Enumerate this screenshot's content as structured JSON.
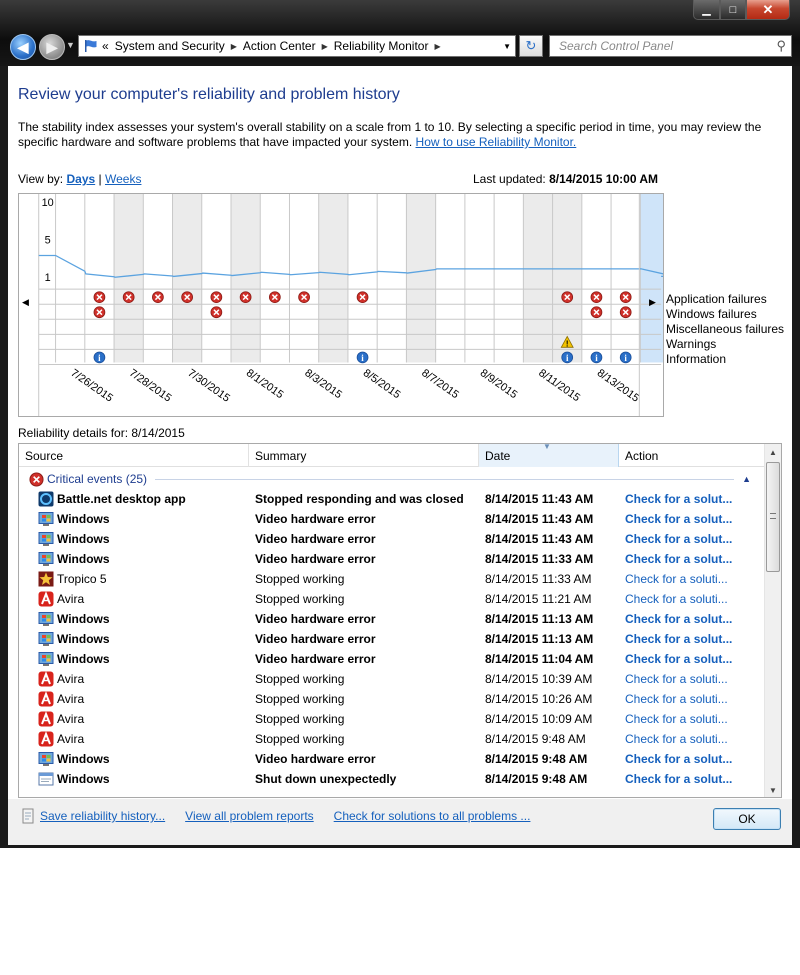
{
  "window": {
    "buttons": {
      "min": "▁",
      "max": "□",
      "close": "✕"
    }
  },
  "address": {
    "overflow": "«",
    "crumbs": [
      "System and Security",
      "Action Center",
      "Reliability Monitor"
    ],
    "search_placeholder": "Search Control Panel"
  },
  "page": {
    "title": "Review your computer's reliability and problem history",
    "description": "The stability index assesses your system's overall stability on a scale from 1 to 10. By selecting a specific period in time, you may review the specific hardware and software problems that have impacted your system.",
    "help_link": "How to use Reliability Monitor.",
    "view_by_label": "View by:",
    "view_days": "Days",
    "view_separator": "|",
    "view_weeks": "Weeks",
    "last_updated_label": "Last updated:",
    "last_updated_value": "8/14/2015 10:00 AM"
  },
  "chart": {
    "y_ticks": [
      "10",
      "5",
      "1"
    ],
    "date_labels": [
      "7/26/2015",
      "7/28/2015",
      "7/30/2015",
      "8/1/2015",
      "8/3/2015",
      "8/5/2015",
      "8/7/2015",
      "8/9/2015",
      "8/11/2015",
      "8/13/2015"
    ],
    "legend": [
      "Application failures",
      "Windows failures",
      "Miscellaneous failures",
      "Warnings",
      "Information"
    ],
    "selected_date": "8/14/2015",
    "stability_index": [
      3.6,
      1.4,
      1.0,
      1.4,
      1.1,
      1.5,
      1.2,
      1.6,
      1.3,
      1.6,
      1.3,
      1.7,
      1.5,
      2.0,
      2.0,
      2.0,
      2.0,
      2.0,
      2.0,
      2.0,
      2.0,
      1.1
    ],
    "application_failure_columns": [
      2,
      3,
      4,
      5,
      6,
      7,
      8,
      9,
      11,
      18,
      19,
      20
    ],
    "windows_failure_columns": [
      2,
      6,
      19,
      20
    ],
    "warning_columns": [
      18
    ],
    "information_columns": [
      2,
      11,
      18,
      19,
      20
    ]
  },
  "details": {
    "label": "Reliability details for: 8/14/2015",
    "columns": {
      "source": "Source",
      "summary": "Summary",
      "date": "Date",
      "action": "Action"
    },
    "group_label": "Critical events (25)",
    "rows": [
      {
        "source": "Battle.net desktop app",
        "icon": "battlenet-icon",
        "summary": "Stopped responding and was closed",
        "date": "8/14/2015 11:43 AM",
        "action": "Check for a solut...",
        "bold": true
      },
      {
        "source": "Windows",
        "icon": "windows-monitor-icon",
        "summary": "Video hardware error",
        "date": "8/14/2015 11:43 AM",
        "action": "Check for a solut...",
        "bold": true
      },
      {
        "source": "Windows",
        "icon": "windows-monitor-icon",
        "summary": "Video hardware error",
        "date": "8/14/2015 11:43 AM",
        "action": "Check for a solut...",
        "bold": true
      },
      {
        "source": "Windows",
        "icon": "windows-monitor-icon",
        "summary": "Video hardware error",
        "date": "8/14/2015 11:33 AM",
        "action": "Check for a solut...",
        "bold": true
      },
      {
        "source": "Tropico 5",
        "icon": "tropico-star-icon",
        "summary": "Stopped working",
        "date": "8/14/2015 11:33 AM",
        "action": "Check for a soluti...",
        "bold": false
      },
      {
        "source": "Avira",
        "icon": "avira-icon",
        "summary": "Stopped working",
        "date": "8/14/2015 11:21 AM",
        "action": "Check for a soluti...",
        "bold": false
      },
      {
        "source": "Windows",
        "icon": "windows-monitor-icon",
        "summary": "Video hardware error",
        "date": "8/14/2015 11:13 AM",
        "action": "Check for a solut...",
        "bold": true
      },
      {
        "source": "Windows",
        "icon": "windows-monitor-icon",
        "summary": "Video hardware error",
        "date": "8/14/2015 11:13 AM",
        "action": "Check for a solut...",
        "bold": true
      },
      {
        "source": "Windows",
        "icon": "windows-monitor-icon",
        "summary": "Video hardware error",
        "date": "8/14/2015 11:04 AM",
        "action": "Check for a solut...",
        "bold": true
      },
      {
        "source": "Avira",
        "icon": "avira-icon",
        "summary": "Stopped working",
        "date": "8/14/2015 10:39 AM",
        "action": "Check for a soluti...",
        "bold": false
      },
      {
        "source": "Avira",
        "icon": "avira-icon",
        "summary": "Stopped working",
        "date": "8/14/2015 10:26 AM",
        "action": "Check for a soluti...",
        "bold": false
      },
      {
        "source": "Avira",
        "icon": "avira-icon",
        "summary": "Stopped working",
        "date": "8/14/2015 10:09 AM",
        "action": "Check for a soluti...",
        "bold": false
      },
      {
        "source": "Avira",
        "icon": "avira-icon",
        "summary": "Stopped working",
        "date": "8/14/2015 9:48 AM",
        "action": "Check for a soluti...",
        "bold": false
      },
      {
        "source": "Windows",
        "icon": "windows-monitor-icon",
        "summary": "Video hardware error",
        "date": "8/14/2015 9:48 AM",
        "action": "Check for a solut...",
        "bold": true
      },
      {
        "source": "Windows",
        "icon": "windows-window-icon",
        "summary": "Shut down unexpectedly",
        "date": "8/14/2015 9:48 AM",
        "action": "Check for a solut...",
        "bold": true
      }
    ]
  },
  "footer": {
    "save_history": "Save reliability history...",
    "view_reports": "View all problem reports",
    "check_solutions": "Check for solutions to all problems ...",
    "ok": "OK"
  },
  "colors": {
    "title_blue": "#1e3d8f",
    "link_blue": "#1560bd",
    "chart_line": "#5ba3e0",
    "selected_column": "#cfe4f9",
    "error_red": "#d0302a",
    "info_blue": "#2a6fc8",
    "warning_yellow": "#f2c200"
  }
}
